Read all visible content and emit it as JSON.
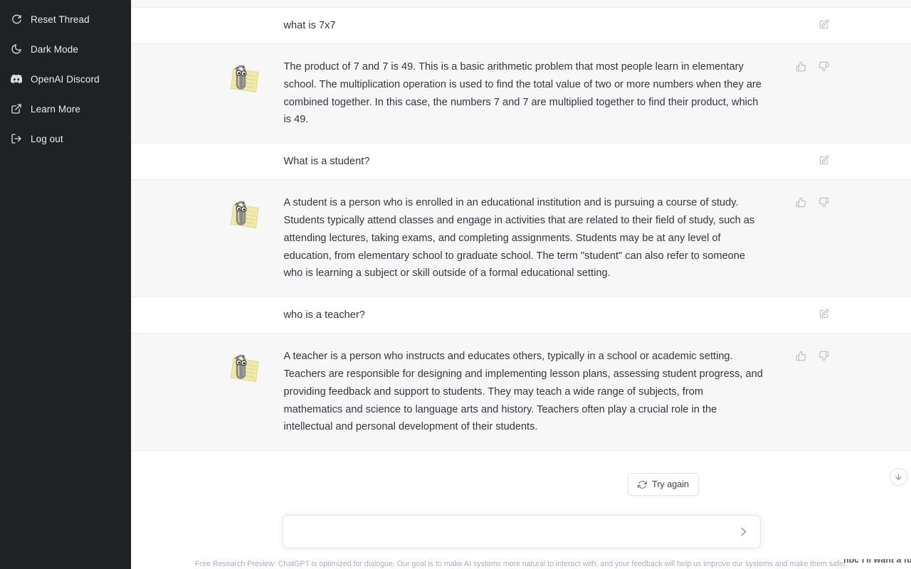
{
  "theme": {
    "sidebar_bg": "#202123",
    "sidebar_text": "#ececf1",
    "assistant_row_bg": "#f7f7f8",
    "user_row_bg": "#ffffff",
    "body_text": "#343541",
    "muted_text": "#acacbe",
    "icon_gray": "#bfbfc7"
  },
  "sidebar": {
    "items": [
      {
        "label": "Reset Thread",
        "icon": "reset-icon"
      },
      {
        "label": "Dark Mode",
        "icon": "moon-icon"
      },
      {
        "label": "OpenAI Discord",
        "icon": "discord-icon"
      },
      {
        "label": "Learn More",
        "icon": "external-link-icon"
      },
      {
        "label": "Log out",
        "icon": "logout-icon"
      }
    ]
  },
  "thread": {
    "messages": [
      {
        "role": "user",
        "text": "what is 7x7",
        "actions": [
          "edit-icon"
        ]
      },
      {
        "role": "assistant",
        "avatar": "clippy-avatar",
        "text": "The product of 7 and 7 is 49. This is a basic arithmetic problem that most people learn in elementary school. The multiplication operation is used to find the total value of two or more numbers when they are combined together. In this case, the numbers 7 and 7 are multiplied together to find their product, which is 49.",
        "actions": [
          "thumbs-up-icon",
          "thumbs-down-icon"
        ]
      },
      {
        "role": "user",
        "text": "What is a student?",
        "actions": [
          "edit-icon"
        ]
      },
      {
        "role": "assistant",
        "avatar": "clippy-avatar",
        "text": "A student is a person who is enrolled in an educational institution and is pursuing a course of study. Students typically attend classes and engage in activities that are related to their field of study, such as attending lectures, taking exams, and completing assignments. Students may be at any level of education, from elementary school to graduate school. The term \"student\" can also refer to someone who is learning a subject or skill outside of a formal educational setting.",
        "actions": [
          "thumbs-up-icon",
          "thumbs-down-icon"
        ]
      },
      {
        "role": "user",
        "text": "who is a teacher?",
        "actions": [
          "edit-icon"
        ]
      },
      {
        "role": "assistant",
        "avatar": "clippy-avatar",
        "text": "A teacher is a person who instructs and educates others, typically in a school or academic setting. Teachers are responsible for designing and implementing lesson plans, assessing student progress, and providing feedback and support to students. They may teach a wide range of subjects, from mathematics and science to language arts and history. Teachers often play a crucial role in the intellectual and personal development of their students.",
        "actions": [
          "thumbs-up-icon",
          "thumbs-down-icon"
        ]
      }
    ]
  },
  "try_again": {
    "label": "Try again",
    "icon": "refresh-icon"
  },
  "scroll_button": {
    "icon": "arrow-down-icon"
  },
  "composer": {
    "value": "",
    "placeholder": "",
    "send_icon": "send-icon"
  },
  "footer": {
    "text": "Free Research Preview: ChatGPT is optimized for dialogue. Our goal is to make AI systems more natural to interact with, and your feedback will help us improve our systems and make them safer."
  },
  "background_window": {
    "partial_text": "nbc  I'll want a full one somewhere even if"
  }
}
